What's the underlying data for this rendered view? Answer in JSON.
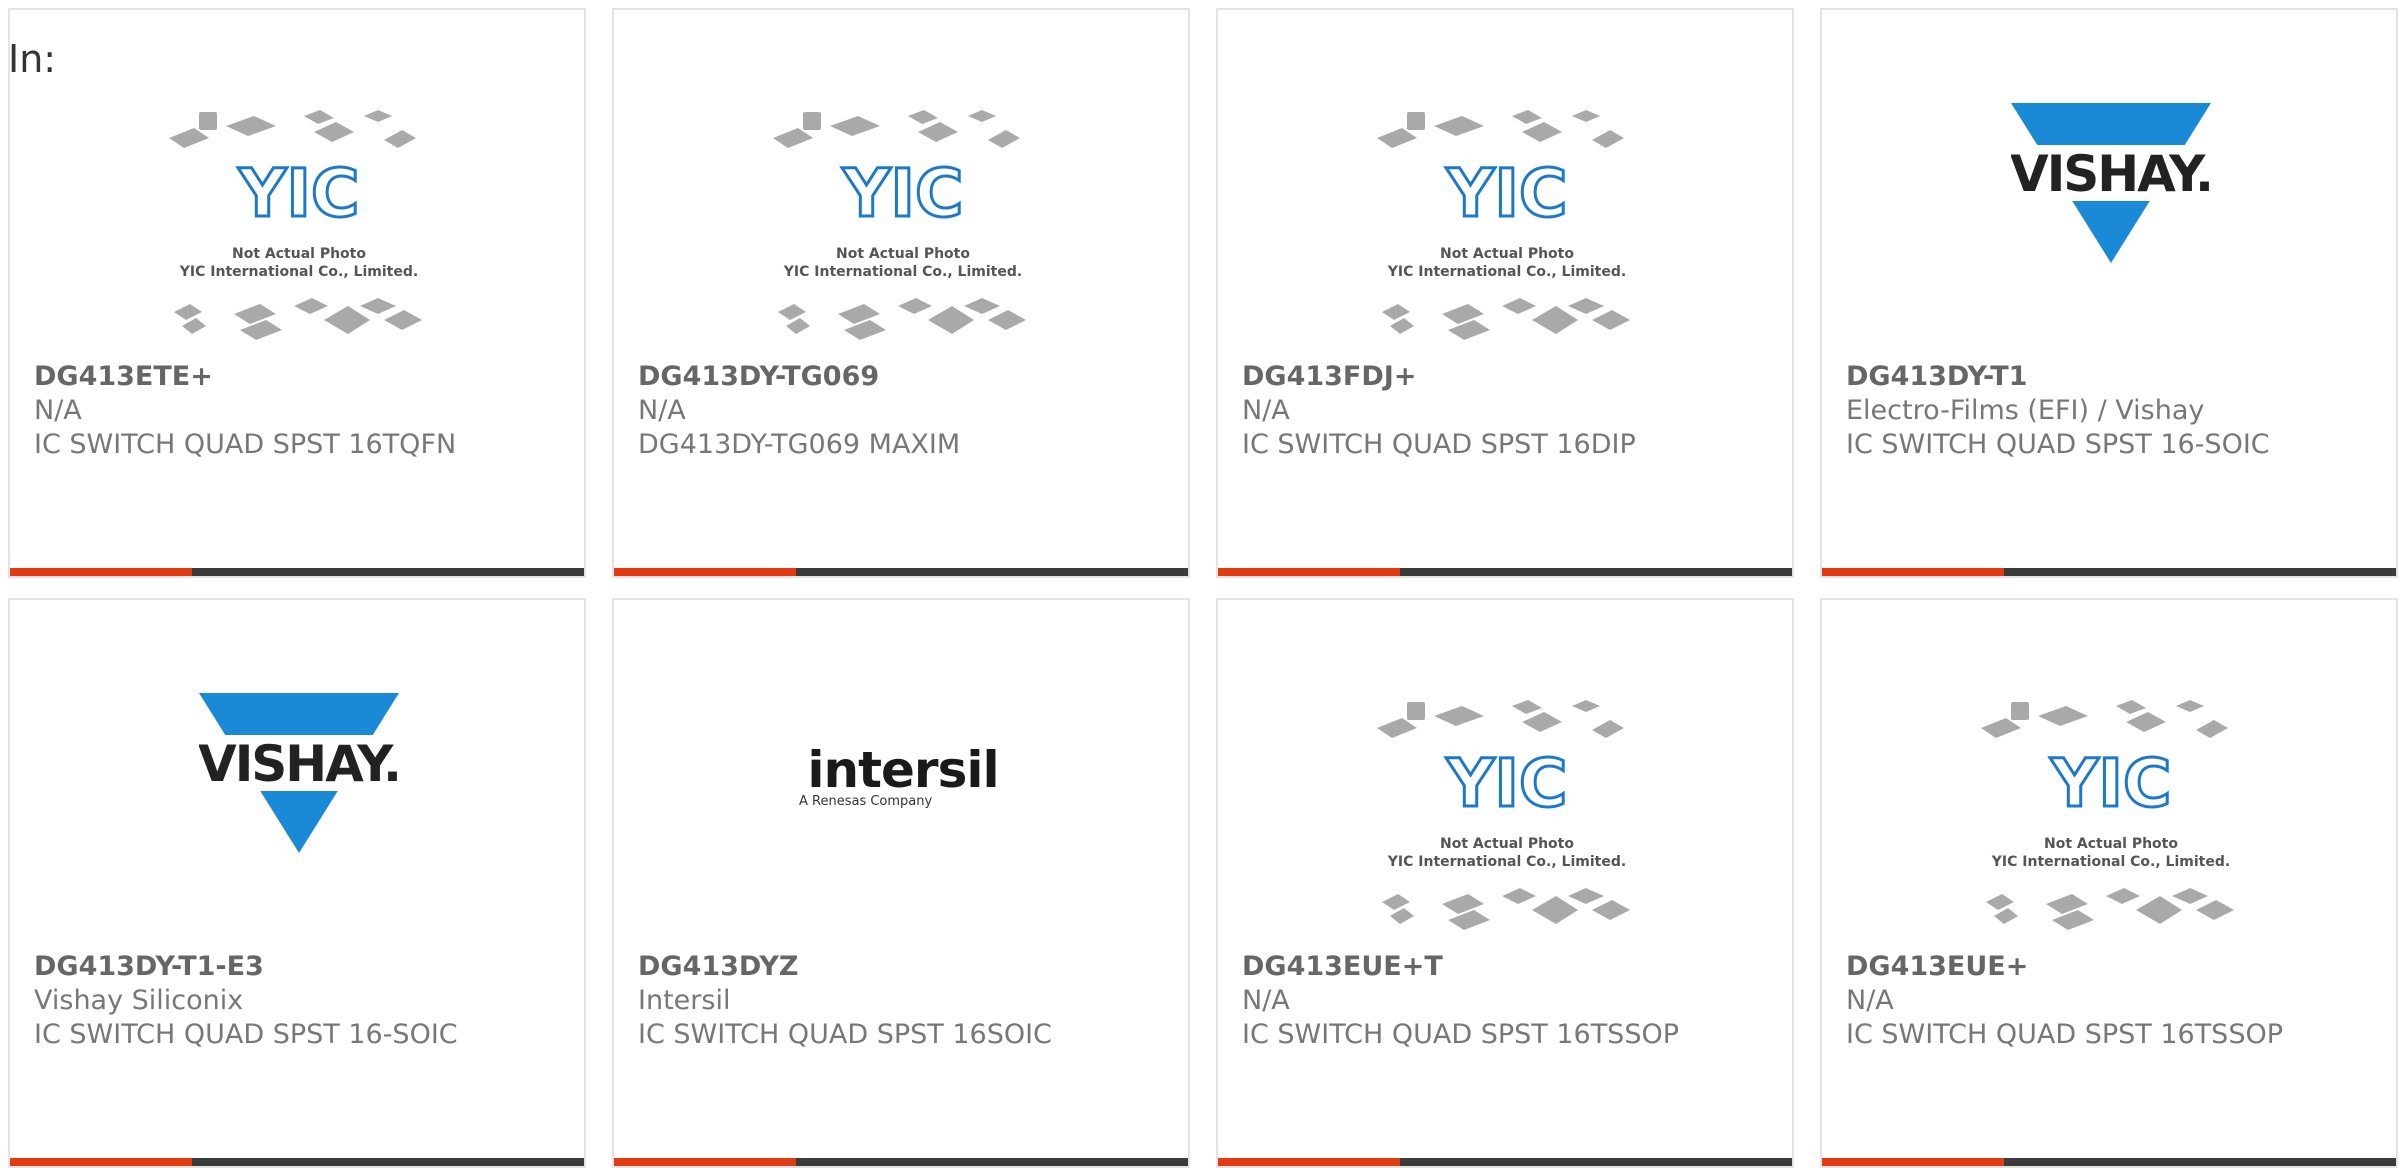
{
  "header": {
    "label": "In:"
  },
  "brand_colors": {
    "accent_bar": "#e23b12",
    "bar_dark": "#3b3b3b",
    "vishay_blue": "#1b8ad6",
    "yic_blue": "#1c79c9"
  },
  "yic_placeholder": {
    "brand": "YIC",
    "line1": "Not Actual Photo",
    "line2": "YIC International Co., Limited."
  },
  "vishay_logo": {
    "text": "VISHAY."
  },
  "intersil_logo": {
    "text": "intersil",
    "sub": "A Renesas Company"
  },
  "products": [
    {
      "part_number": "DG413ETE+",
      "manufacturer": "N/A",
      "description": "IC SWITCH QUAD SPST 16TQFN",
      "image": "yic-placeholder"
    },
    {
      "part_number": "DG413DY-TG069",
      "manufacturer": "N/A",
      "description": "DG413DY-TG069 MAXIM",
      "image": "yic-placeholder"
    },
    {
      "part_number": "DG413FDJ+",
      "manufacturer": "N/A",
      "description": "IC SWITCH QUAD SPST 16DIP",
      "image": "yic-placeholder"
    },
    {
      "part_number": "DG413DY-T1",
      "manufacturer": "Electro-Films (EFI) / Vishay",
      "description": "IC SWITCH QUAD SPST 16-SOIC",
      "image": "vishay-logo"
    },
    {
      "part_number": "DG413DY-T1-E3",
      "manufacturer": "Vishay Siliconix",
      "description": "IC SWITCH QUAD SPST 16-SOIC",
      "image": "vishay-logo"
    },
    {
      "part_number": "DG413DYZ",
      "manufacturer": "Intersil",
      "description": "IC SWITCH QUAD SPST 16SOIC",
      "image": "intersil-logo"
    },
    {
      "part_number": "DG413EUE+T",
      "manufacturer": "N/A",
      "description": "IC SWITCH QUAD SPST 16TSSOP",
      "image": "yic-placeholder"
    },
    {
      "part_number": "DG413EUE+",
      "manufacturer": "N/A",
      "description": "IC SWITCH QUAD SPST 16TSSOP",
      "image": "yic-placeholder"
    }
  ]
}
